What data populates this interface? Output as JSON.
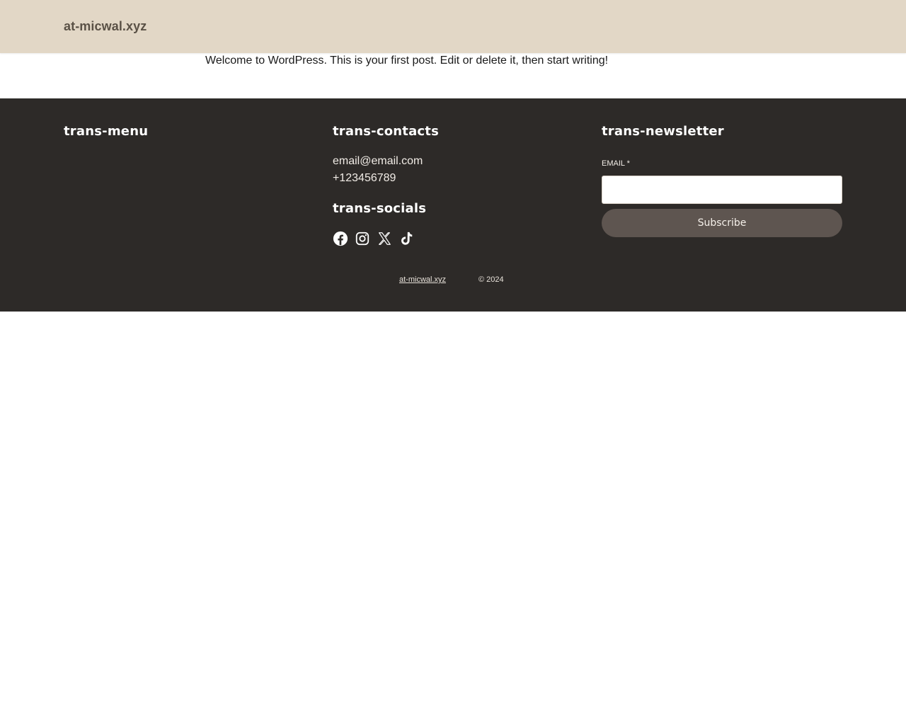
{
  "header": {
    "site_title": "at-micwal.xyz",
    "background": "#e2d7c6"
  },
  "post": {
    "text": "Welcome to WordPress. This is your first post. Edit or delete it, then start writing!"
  },
  "footer": {
    "background": "#2d2a28",
    "menu": {
      "heading": "trans-menu"
    },
    "contacts": {
      "heading": "trans-contacts",
      "email": "email@email.com",
      "phone": "+123456789"
    },
    "socials": {
      "heading": "trans-socials",
      "icons": [
        "facebook-icon",
        "instagram-icon",
        "x-icon",
        "tiktok-icon"
      ]
    },
    "newsletter": {
      "heading": "trans-newsletter",
      "email_label": "EMAIL *",
      "email_value": "",
      "subscribe_label": "Subscribe",
      "button_color": "#5e5550"
    },
    "bottom": {
      "site_name": "at-micwal.xyz",
      "copyright": "© 2024"
    }
  }
}
